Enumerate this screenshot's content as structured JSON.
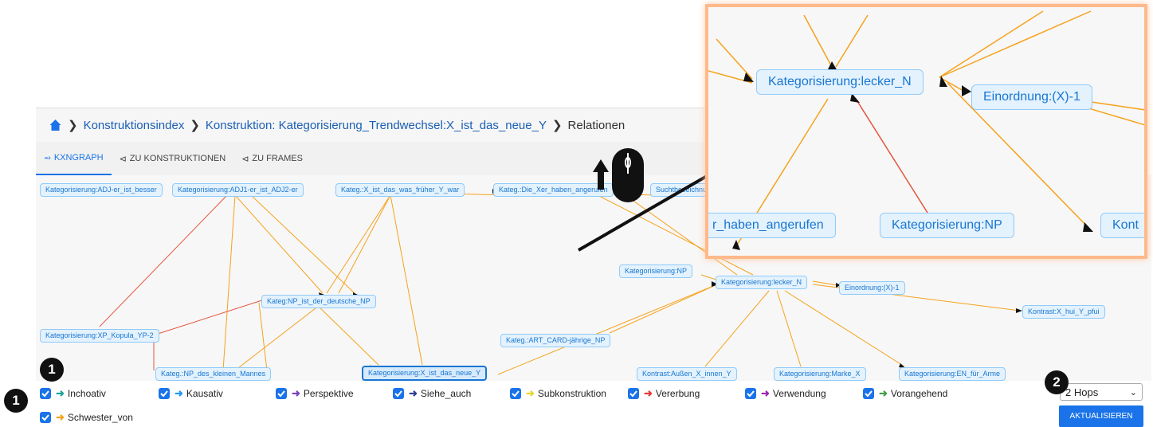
{
  "breadcrumb": {
    "items": [
      "Konstruktionsindex",
      "Konstruktion: Kategorisierung_Trendwechsel:X_ist_das_neue_Y",
      "Relationen"
    ]
  },
  "tabs": [
    {
      "label": "KXNGRAPH",
      "icon": "graph-icon",
      "active": true
    },
    {
      "label": "ZU KONSTRUKTIONEN",
      "icon": "share-icon",
      "active": false
    },
    {
      "label": "ZU FRAMES",
      "icon": "share-icon",
      "active": false
    }
  ],
  "graph": {
    "nodes": [
      "Kategorisierung:ADJ-er_ist_besser",
      "Kategorisierung:ADJ1-er_ist_ADJ2-er",
      "Kateg.:X_ist_das_was_früher_Y_war",
      "Kateg.:Die_Xer_haben_angerufen",
      "Suchtbezeichnu",
      "Kategorisierung:NP",
      "Kategorisierung:lecker_N",
      "Einordnung:(X)-1",
      "Kontrast:X_hui_Y_pfui",
      "Kateg:NP_ist_der_deutsche_NP",
      "Kategorisierung:XP_Kopula_YP-2",
      "Kateg.:ART_CARD-jährige_NP",
      "Kateg.:NP_des_kleinen_Mannes",
      "Kategorisierung:X_ist_das_neue_Y",
      "Kontrast:Außen_X_innen_Y",
      "Kategorisierung:Marke_X",
      "Kategorisierung:EN_für_Arme"
    ]
  },
  "zoom": {
    "nodes": [
      "Kategorisierung:lecker_N",
      "Einordnung:(X)-1",
      "r_haben_angerufen",
      "Kategorisierung:NP",
      "Kont"
    ]
  },
  "relations": [
    {
      "label": "Inchoativ",
      "color": "#1aa39a"
    },
    {
      "label": "Kausativ",
      "color": "#2196f3"
    },
    {
      "label": "Perspektive",
      "color": "#7b3fbf"
    },
    {
      "label": "Siehe_auch",
      "color": "#2c3e8f"
    },
    {
      "label": "Subkonstruktion",
      "color": "#e6d52e"
    },
    {
      "label": "Vererbung",
      "color": "#e53935"
    },
    {
      "label": "Verwendung",
      "color": "#9c27b0"
    },
    {
      "label": "Vorangehend",
      "color": "#43a047"
    },
    {
      "label": "Schwester_von",
      "color": "#f6a21c"
    }
  ],
  "hops": {
    "value": "2 Hops"
  },
  "update_label": "AKTUALISIEREN",
  "badges": [
    "1",
    "1",
    "2"
  ]
}
